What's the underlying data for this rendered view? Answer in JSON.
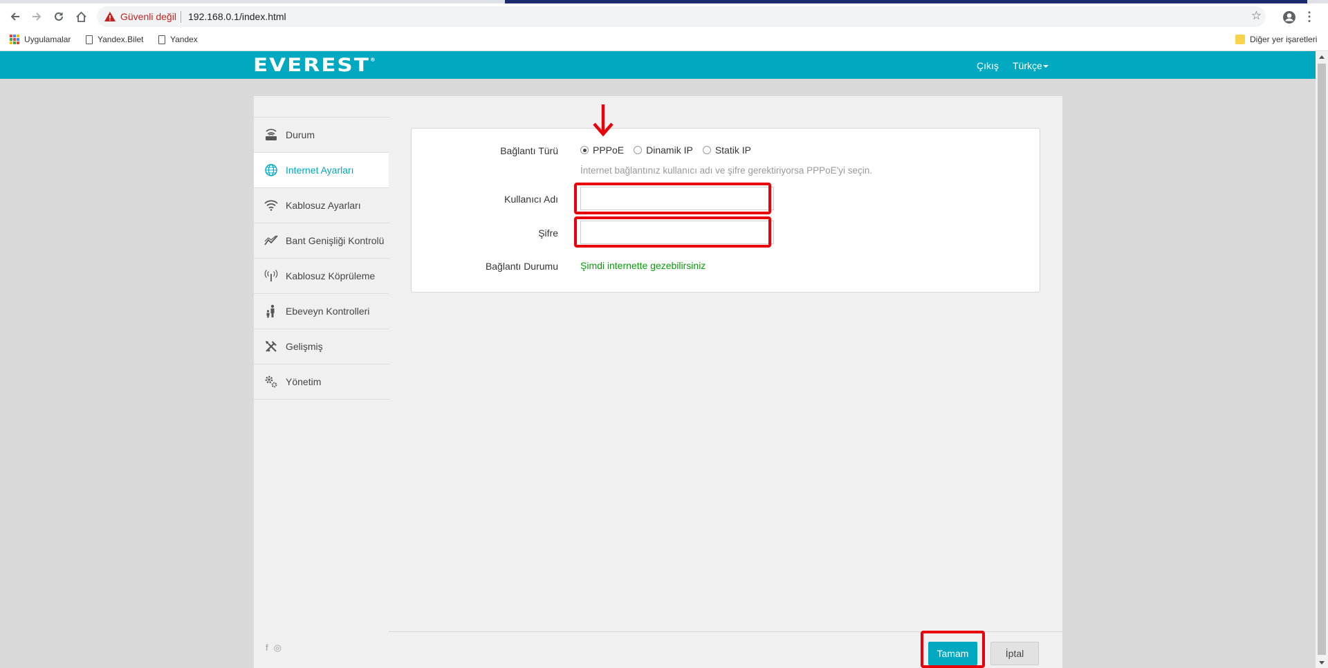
{
  "browser": {
    "insecure_label": "Güvenli değil",
    "url": "192.168.0.1/index.html",
    "bookmarks": [
      {
        "label": "Uygulamalar",
        "icon": "apps-icon"
      },
      {
        "label": "Yandex.Bilet",
        "icon": "page-icon"
      },
      {
        "label": "Yandex",
        "icon": "page-icon"
      }
    ],
    "other_bookmarks": "Diğer yer işaretleri"
  },
  "header": {
    "brand": "EVEREST",
    "brand_mark": "®",
    "logout": "Çıkış",
    "language": "Türkçe",
    "color": "#00a9c0"
  },
  "sidebar": {
    "items": [
      {
        "label": "Durum",
        "icon": "router-icon",
        "active": false
      },
      {
        "label": "Internet Ayarları",
        "icon": "globe-icon",
        "active": true
      },
      {
        "label": "Kablosuz Ayarları",
        "icon": "wifi-icon",
        "active": false
      },
      {
        "label": "Bant Genişliği Kontrolü",
        "icon": "chart-line-icon",
        "active": false
      },
      {
        "label": "Kablosuz Köprüleme",
        "icon": "antenna-icon",
        "active": false
      },
      {
        "label": "Ebeveyn Kontrolleri",
        "icon": "parent-child-icon",
        "active": false
      },
      {
        "label": "Gelişmiş",
        "icon": "tools-icon",
        "active": false
      },
      {
        "label": "Yönetim",
        "icon": "gears-icon",
        "active": false
      }
    ],
    "social": {
      "facebook": "f",
      "instagram": "◎"
    }
  },
  "form": {
    "connection_type_label": "Bağlantı Türü",
    "options": [
      "PPPoE",
      "Dinamik IP",
      "Statik IP"
    ],
    "selected": "PPPoE",
    "hint": "İnternet bağlantınız kullanıcı adı ve şifre gerektiriyorsa PPPoE'yi seçin.",
    "username_label": "Kullanıcı Adı",
    "username_value": "",
    "password_label": "Şifre",
    "password_value": "",
    "status_label": "Bağlantı Durumu",
    "status_value": "Şimdi internette gezebilirsiniz",
    "status_color": "#0a9b0a",
    "highlight_color": "#e8000b"
  },
  "actions": {
    "ok": "Tamam",
    "cancel": "İptal"
  }
}
